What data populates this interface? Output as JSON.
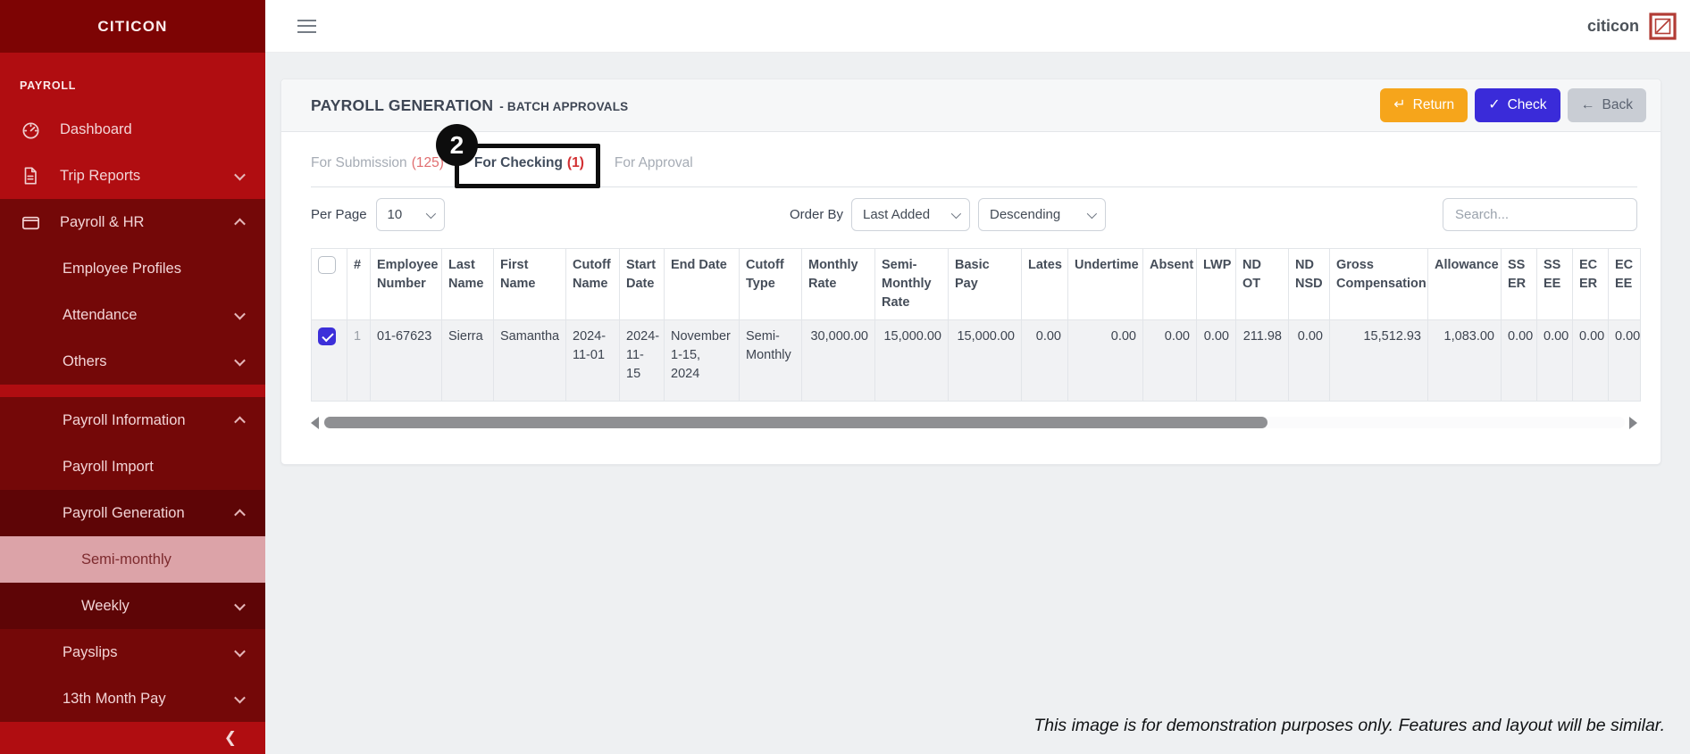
{
  "colors": {
    "sidebar_base": "#b00d11",
    "sidebar_dark": "#740808",
    "sidebar_darker": "#5e0506",
    "sidebar_header": "#7d0404",
    "active_item_bg": "#dca3a8",
    "active_item_text": "#7d2a2e",
    "return_button": "#f6a51b",
    "check_button": "#3a2bd9",
    "back_button": "#c9cdd4",
    "checkbox_checked": "#3c2fd9",
    "count_red": "#d22f32",
    "annotation_black": "#0d0d0d"
  },
  "sidebar": {
    "logo": "CITICON",
    "section_label": "PAYROLL",
    "items": [
      {
        "label": "Dashboard",
        "icon": "dashboard",
        "level": 1,
        "bg": "base"
      },
      {
        "label": "Trip Reports",
        "icon": "document",
        "level": 1,
        "bg": "base",
        "chevron": "down"
      },
      {
        "label": "Payroll & HR",
        "icon": "wallet",
        "level": 1,
        "bg": "dark",
        "chevron": "up"
      },
      {
        "label": "Employee Profiles",
        "level": 2,
        "bg": "dark"
      },
      {
        "label": "Attendance",
        "level": 2,
        "bg": "dark",
        "chevron": "down"
      },
      {
        "label": "Others",
        "level": 2,
        "bg": "dark",
        "chevron": "down",
        "gap_after": true
      },
      {
        "label": "Payroll Information",
        "level": 2,
        "bg": "dark",
        "chevron": "up"
      },
      {
        "label": "Payroll Import",
        "level": 2,
        "bg": "dark"
      },
      {
        "label": "Payroll Generation",
        "level": 2,
        "bg": "darker",
        "chevron": "up"
      },
      {
        "label": "Semi-monthly",
        "level": 3,
        "active": true
      },
      {
        "label": "Weekly",
        "level": 3,
        "bg": "darker",
        "chevron": "down"
      },
      {
        "label": "Payslips",
        "level": 2,
        "bg": "dark",
        "chevron": "down"
      },
      {
        "label": "13th Month Pay",
        "level": 2,
        "bg": "dark",
        "chevron": "down"
      }
    ]
  },
  "topbar": {
    "brand": "citicon"
  },
  "panel": {
    "title": "PAYROLL GENERATION",
    "subtitle": "- BATCH APPROVALS",
    "buttons": [
      {
        "label": "Return",
        "icon": "↵",
        "style": "warning",
        "icon_name": "return-arrow-icon"
      },
      {
        "label": "Check",
        "icon": "✓",
        "style": "primary",
        "icon_name": "check-icon"
      },
      {
        "label": "Back",
        "icon": "←",
        "style": "secondary",
        "icon_name": "back-arrow-icon"
      }
    ]
  },
  "tabs": [
    {
      "label": "For Submission",
      "count": "(125)",
      "active": false
    },
    {
      "label": "For Checking",
      "count": "(1)",
      "active": true
    },
    {
      "label": "For Approval",
      "count": "",
      "active": false
    }
  ],
  "annotation": {
    "badge": "2"
  },
  "controls": {
    "per_page_label": "Per Page",
    "per_page_value": "10",
    "order_by_label": "Order By",
    "order_by_value": "Last Added",
    "direction_value": "Descending",
    "search_placeholder": "Search..."
  },
  "table": {
    "columns": [
      "",
      "#",
      "Employee Number",
      "Last Name",
      "First Name",
      "Cutoff Name",
      "Start Date",
      "End Date",
      "Cutoff Type",
      "Monthly Rate",
      "Semi-Monthly Rate",
      "Basic Pay",
      "Lates",
      "Undertime",
      "Absent",
      "LWP",
      "ND OT",
      "ND NSD",
      "Gross Compensation",
      "Allowance",
      "SS ER",
      "SS EE",
      "EC ER",
      "EC EE"
    ],
    "rows": [
      {
        "checked": true,
        "cells": [
          "1",
          "01-67623",
          "Sierra",
          "Samantha",
          "2024-11-01",
          "2024-11-15",
          "November 1-15, 2024",
          "Semi-Monthly",
          "30,000.00",
          "15,000.00",
          "15,000.00",
          "0.00",
          "0.00",
          "0.00",
          "0.00",
          "211.98",
          "0.00",
          "15,512.93",
          "1,083.00",
          "0.00",
          "0.00",
          "0.00",
          "0.00"
        ]
      }
    ]
  },
  "disclaimer": "This image is for demonstration purposes only. Features and layout will be similar."
}
